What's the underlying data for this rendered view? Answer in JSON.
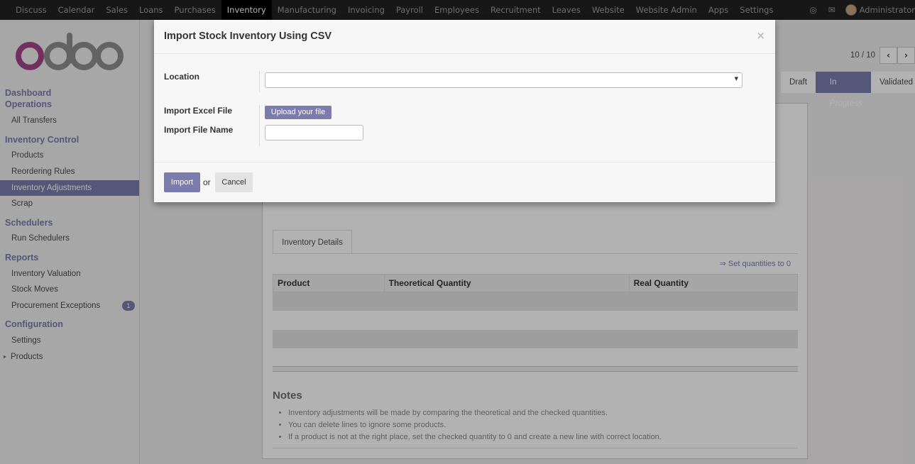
{
  "topnav": {
    "menu": [
      "Discuss",
      "Calendar",
      "Sales",
      "Loans",
      "Purchases",
      "Inventory",
      "Manufacturing",
      "Invoicing",
      "Payroll",
      "Employees",
      "Recruitment",
      "Leaves",
      "Website",
      "Website Admin",
      "Apps",
      "Settings"
    ],
    "active": "Inventory",
    "user": "Administrator",
    "icons": [
      "globe-icon",
      "chat-icon"
    ]
  },
  "sidebar": {
    "sections": [
      {
        "title": "Dashboard",
        "items": []
      },
      {
        "title": "Operations",
        "items": [
          "All Transfers"
        ]
      },
      {
        "title": "Inventory Control",
        "items": [
          "Products",
          "Reordering Rules",
          "Inventory Adjustments",
          "Scrap"
        ]
      },
      {
        "title": "Schedulers",
        "items": [
          "Run Schedulers"
        ]
      },
      {
        "title": "Reports",
        "items": [
          "Inventory Valuation",
          "Stock Moves",
          "Procurement Exceptions"
        ]
      },
      {
        "title": "Configuration",
        "items": [
          "Settings",
          "Products"
        ]
      }
    ],
    "active_item": "Inventory Adjustments",
    "badge": "1"
  },
  "main": {
    "pager": "10 / 10",
    "statuses": [
      "Draft",
      "In Progress",
      "Validated"
    ],
    "current_status": "In Progress",
    "tab": "Inventory Details",
    "set_quantities": "⇒ Set quantities to 0",
    "columns": [
      "Product",
      "Theoretical Quantity",
      "Real Quantity"
    ],
    "notes_title": "Notes",
    "notes": [
      "Inventory adjustments will be made by comparing the theoretical and the checked quantities.",
      "You can delete lines to ignore some products.",
      "If a product is not at the right place, set the checked quantity to 0 and create a new line with correct location."
    ]
  },
  "modal": {
    "title": "Import Stock Inventory Using CSV",
    "close": "×",
    "location_label": "Location",
    "location_value": "",
    "excel_label": "Import Excel File",
    "upload_label": "Upload your file",
    "filename_label": "Import File Name",
    "filename_value": "",
    "import_label": "Import",
    "or_text": "or",
    "cancel_label": "Cancel"
  },
  "colors": {
    "accent": "#7c7bad",
    "navbar": "#222222"
  }
}
